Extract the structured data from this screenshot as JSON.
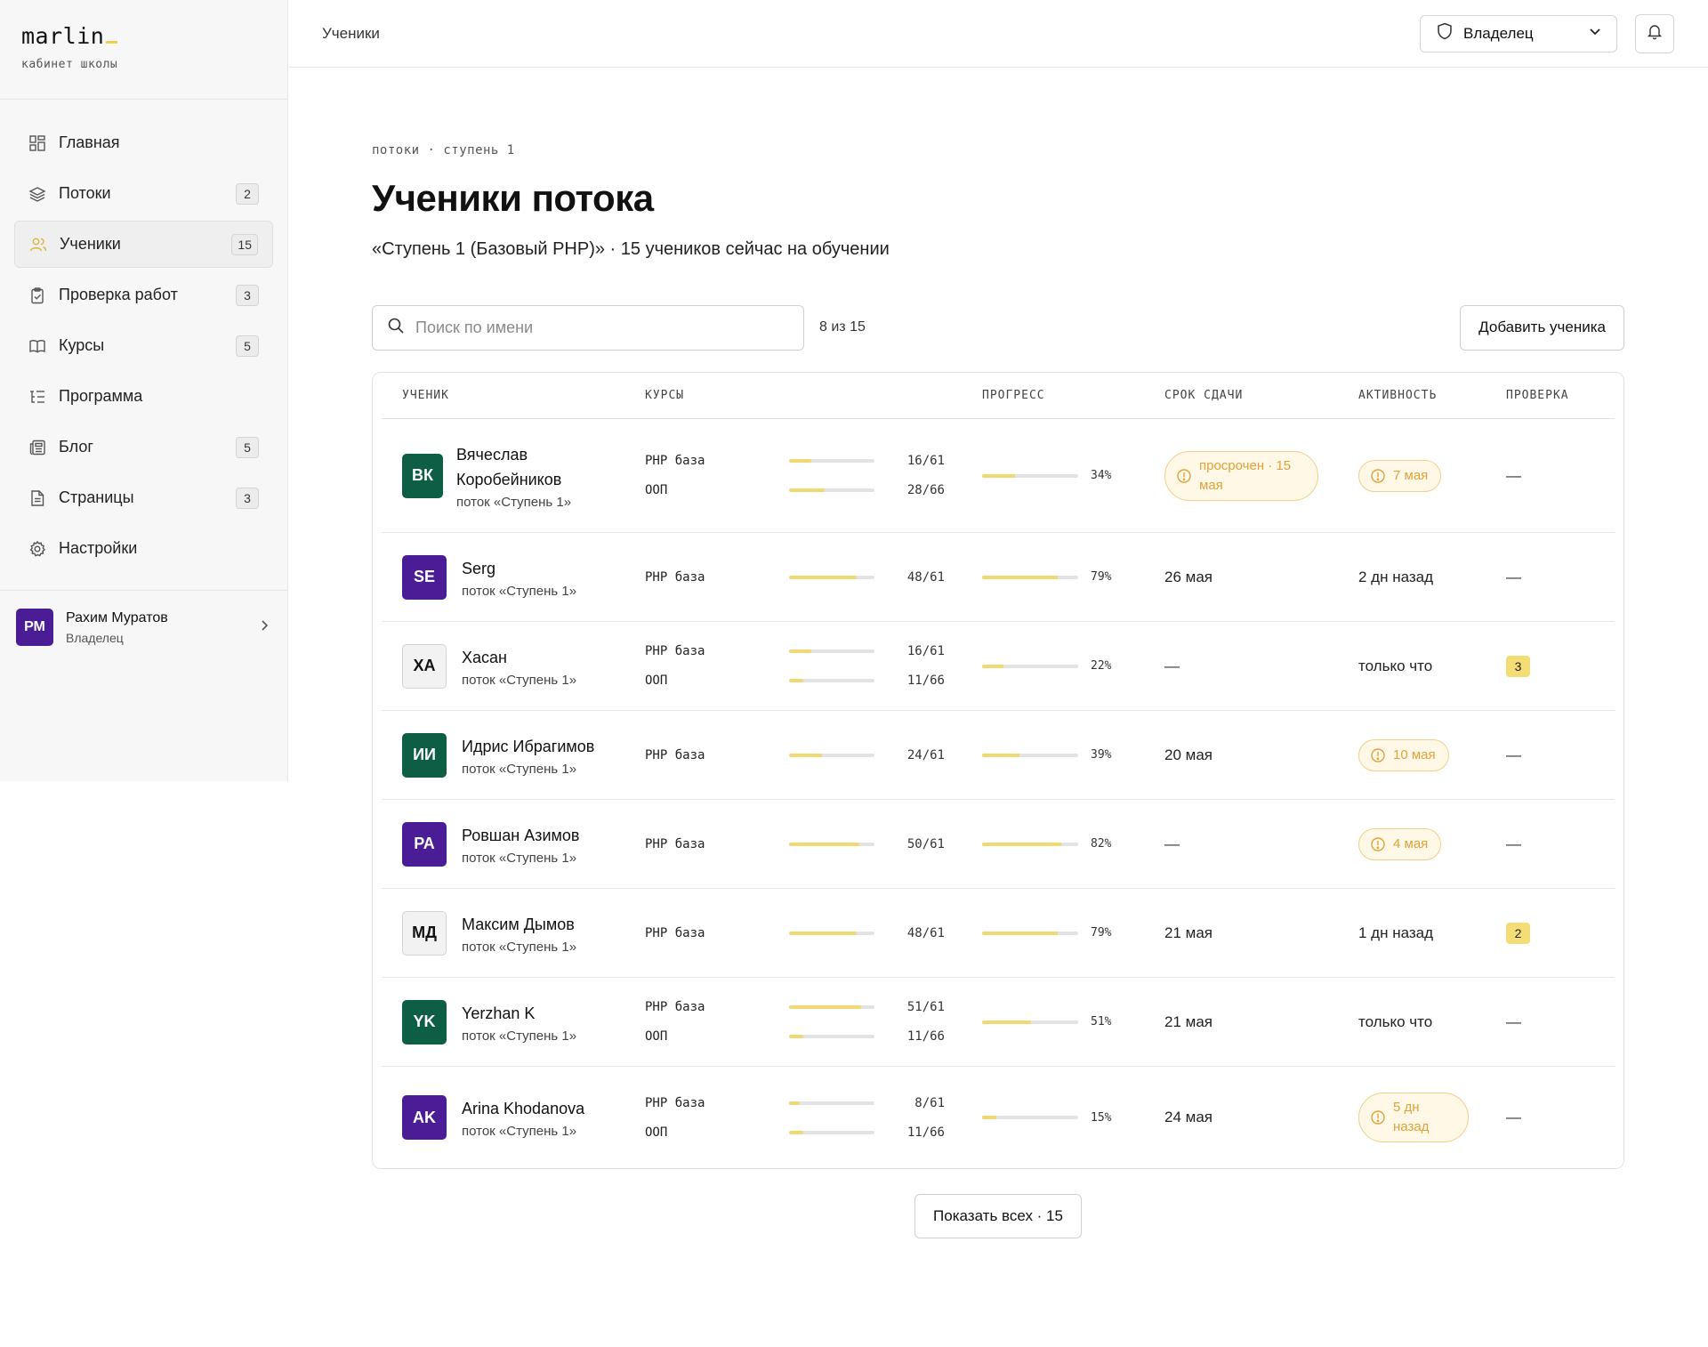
{
  "brand": {
    "name": "marlin",
    "subtitle": "кабинет школы"
  },
  "nav": {
    "items": [
      {
        "label": "Главная",
        "badge": "",
        "icon": "grid-icon"
      },
      {
        "label": "Потоки",
        "badge": "2",
        "icon": "layers-icon"
      },
      {
        "label": "Ученики",
        "badge": "15",
        "icon": "users-icon",
        "active": true
      },
      {
        "label": "Проверка работ",
        "badge": "3",
        "icon": "clipboard-check-icon"
      },
      {
        "label": "Курсы",
        "badge": "5",
        "icon": "book-icon"
      },
      {
        "label": "Программа",
        "badge": "",
        "icon": "list-tree-icon"
      },
      {
        "label": "Блог",
        "badge": "5",
        "icon": "newspaper-icon"
      },
      {
        "label": "Страницы",
        "badge": "3",
        "icon": "file-icon"
      },
      {
        "label": "Настройки",
        "badge": "",
        "icon": "gear-icon"
      }
    ]
  },
  "user": {
    "initials": "РМ",
    "name": "Рахим Муратов",
    "role": "Владелец"
  },
  "topbar": {
    "title": "Ученики",
    "role_select": "Владелец"
  },
  "page": {
    "breadcrumb": "потоки · ступень 1",
    "title": "Ученики потока",
    "subtitle": "«Ступень 1 (Базовый PHP)» · 15 учеников сейчас на обучении"
  },
  "toolbar": {
    "search_placeholder": "Поиск по имени",
    "count": "8 из 15",
    "add_button": "Добавить ученика"
  },
  "table": {
    "headers": {
      "student": "УЧЕНИК",
      "courses": "КУРСЫ",
      "progress": "ПРОГРЕСС",
      "deadline": "СРОК СДАЧИ",
      "activity": "АКТИВНОСТЬ",
      "review": "ПРОВЕРКА"
    },
    "rows": [
      {
        "initials": "ВК",
        "name": "Вячеслав Коробейников",
        "stream": "поток «Ступень 1»",
        "courses": [
          {
            "name": "PHP база",
            "done": "16/61"
          },
          {
            "name": "ООП",
            "done": "28/66"
          }
        ],
        "progress": "34%",
        "deadline": "просрочен · 15 мая",
        "activity": "7 мая",
        "review": "—"
      },
      {
        "initials": "SE",
        "name": "Serg",
        "stream": "поток «Ступень 1»",
        "courses": [
          {
            "name": "PHP база",
            "done": "48/61"
          }
        ],
        "progress": "79%",
        "deadline": "26 мая",
        "activity": "2 дн назад",
        "review": "—"
      },
      {
        "initials": "ХА",
        "name": "Хасан",
        "stream": "поток «Ступень 1»",
        "courses": [
          {
            "name": "PHP база",
            "done": "16/61"
          },
          {
            "name": "ООП",
            "done": "11/66"
          }
        ],
        "progress": "22%",
        "deadline": "—",
        "activity": "только что",
        "review": "3"
      },
      {
        "initials": "ИИ",
        "name": "Идрис Ибрагимов",
        "stream": "поток «Ступень 1»",
        "courses": [
          {
            "name": "PHP база",
            "done": "24/61"
          }
        ],
        "progress": "39%",
        "deadline": "20 мая",
        "activity": "10 мая",
        "review": "—"
      },
      {
        "initials": "РА",
        "name": "Ровшан Азимов",
        "stream": "поток «Ступень 1»",
        "courses": [
          {
            "name": "PHP база",
            "done": "50/61"
          }
        ],
        "progress": "82%",
        "deadline": "—",
        "activity": "4 мая",
        "review": "—"
      },
      {
        "initials": "МД",
        "name": "Максим Дымов",
        "stream": "поток «Ступень 1»",
        "courses": [
          {
            "name": "PHP база",
            "done": "48/61"
          }
        ],
        "progress": "79%",
        "deadline": "21 мая",
        "activity": "1 дн назад",
        "review": "2"
      },
      {
        "initials": "YK",
        "name": "Yerzhan K",
        "stream": "поток «Ступень 1»",
        "courses": [
          {
            "name": "PHP база",
            "done": "51/61"
          },
          {
            "name": "ООП",
            "done": "11/66"
          }
        ],
        "progress": "51%",
        "deadline": "21 мая",
        "activity": "только что",
        "review": "—"
      },
      {
        "initials": "AK",
        "name": "Arina Khodanova",
        "stream": "поток «Ступень 1»",
        "courses": [
          {
            "name": "PHP база",
            "done": "8/61"
          },
          {
            "name": "ООП",
            "done": "11/66"
          }
        ],
        "progress": "15%",
        "deadline": "24 мая",
        "activity": "5 дн назад",
        "review": "—"
      }
    ]
  },
  "show_all": "Показать всех · 15",
  "colors": {
    "accent": "#f2d873",
    "warning": "#e0a23a",
    "avatar_green": "#0e5e45",
    "avatar_purple": "#4a1d96"
  }
}
